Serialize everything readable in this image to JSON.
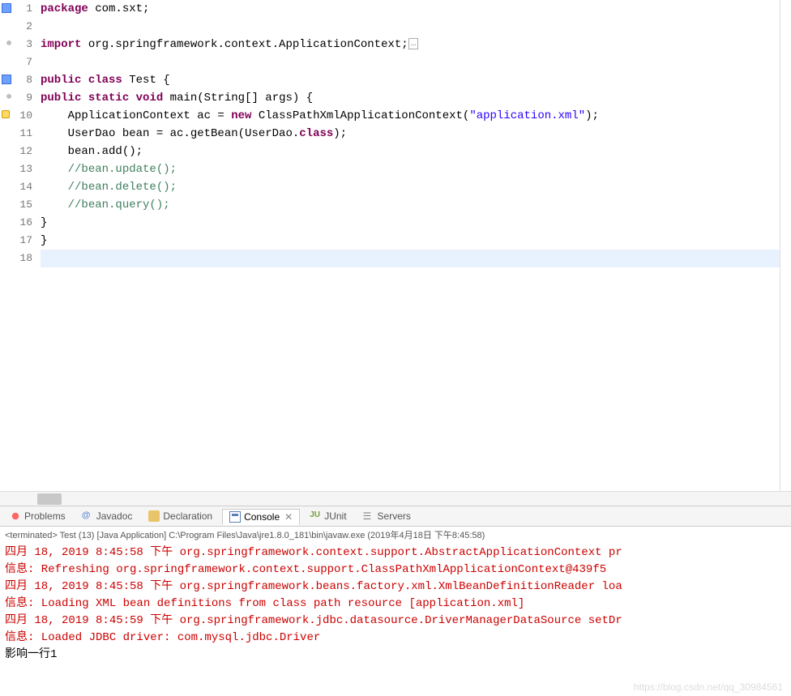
{
  "editor": {
    "lines": [
      {
        "n": "1",
        "marker": "blue",
        "segs": [
          {
            "t": "package",
            "c": "kw"
          },
          {
            "t": " com.sxt;",
            "c": "plain"
          }
        ]
      },
      {
        "n": "2",
        "segs": []
      },
      {
        "n": "3",
        "marker": "import",
        "segs": [
          {
            "t": "import",
            "c": "kw"
          },
          {
            "t": " org.springframework.context.ApplicationContext;",
            "c": "plain"
          }
        ],
        "collapsed": true
      },
      {
        "n": "7",
        "segs": []
      },
      {
        "n": "8",
        "marker": "blue",
        "segs": [
          {
            "t": "public",
            "c": "kw"
          },
          {
            "t": " ",
            "c": "plain"
          },
          {
            "t": "class",
            "c": "kw"
          },
          {
            "t": " Test {",
            "c": "plain"
          }
        ]
      },
      {
        "n": "9",
        "marker": "import",
        "segs": [
          {
            "t": "public",
            "c": "kw"
          },
          {
            "t": " ",
            "c": "plain"
          },
          {
            "t": "static",
            "c": "kw"
          },
          {
            "t": " ",
            "c": "plain"
          },
          {
            "t": "void",
            "c": "kw"
          },
          {
            "t": " main(String[] args) {",
            "c": "plain"
          }
        ]
      },
      {
        "n": "10",
        "marker": "warn",
        "segs": [
          {
            "t": "    ApplicationContext ac = ",
            "c": "plain"
          },
          {
            "t": "new",
            "c": "kw"
          },
          {
            "t": " ClassPathXmlApplicationContext(",
            "c": "plain"
          },
          {
            "t": "\"application.xml\"",
            "c": "str"
          },
          {
            "t": ");",
            "c": "plain"
          }
        ]
      },
      {
        "n": "11",
        "segs": [
          {
            "t": "    UserDao bean = ac.getBean(UserDao.",
            "c": "plain"
          },
          {
            "t": "class",
            "c": "kw"
          },
          {
            "t": ");",
            "c": "plain"
          }
        ]
      },
      {
        "n": "12",
        "segs": [
          {
            "t": "    bean.add();",
            "c": "plain"
          }
        ]
      },
      {
        "n": "13",
        "segs": [
          {
            "t": "    ",
            "c": "plain"
          },
          {
            "t": "//bean.update();",
            "c": "cmt"
          }
        ]
      },
      {
        "n": "14",
        "segs": [
          {
            "t": "    ",
            "c": "plain"
          },
          {
            "t": "//bean.delete();",
            "c": "cmt"
          }
        ]
      },
      {
        "n": "15",
        "segs": [
          {
            "t": "    ",
            "c": "plain"
          },
          {
            "t": "//bean.query();",
            "c": "cmt"
          }
        ]
      },
      {
        "n": "16",
        "segs": [
          {
            "t": "}",
            "c": "plain"
          }
        ]
      },
      {
        "n": "17",
        "segs": [
          {
            "t": "}",
            "c": "plain"
          }
        ]
      },
      {
        "n": "18",
        "current": true,
        "segs": []
      }
    ]
  },
  "tabs": {
    "problems": "Problems",
    "javadoc": "Javadoc",
    "declaration": "Declaration",
    "console": "Console",
    "junit": "JUnit",
    "servers": "Servers"
  },
  "console": {
    "status": "<terminated> Test (13) [Java Application] C:\\Program Files\\Java\\jre1.8.0_181\\bin\\javaw.exe (2019年4月18日 下午8:45:58)",
    "lines": [
      {
        "c": "err",
        "t": "四月 18, 2019 8:45:58 下午 org.springframework.context.support.AbstractApplicationContext pr"
      },
      {
        "c": "err",
        "t": "信息: Refreshing org.springframework.context.support.ClassPathXmlApplicationContext@439f5"
      },
      {
        "c": "err",
        "t": "四月 18, 2019 8:45:58 下午 org.springframework.beans.factory.xml.XmlBeanDefinitionReader loa"
      },
      {
        "c": "err",
        "t": "信息: Loading XML bean definitions from class path resource [application.xml]"
      },
      {
        "c": "err",
        "t": "四月 18, 2019 8:45:59 下午 org.springframework.jdbc.datasource.DriverManagerDataSource setDr"
      },
      {
        "c": "err",
        "t": "信息: Loaded JDBC driver: com.mysql.jdbc.Driver"
      },
      {
        "c": "out",
        "t": "影响一行1"
      }
    ]
  },
  "watermark": "https://blog.csdn.net/qq_30984561"
}
